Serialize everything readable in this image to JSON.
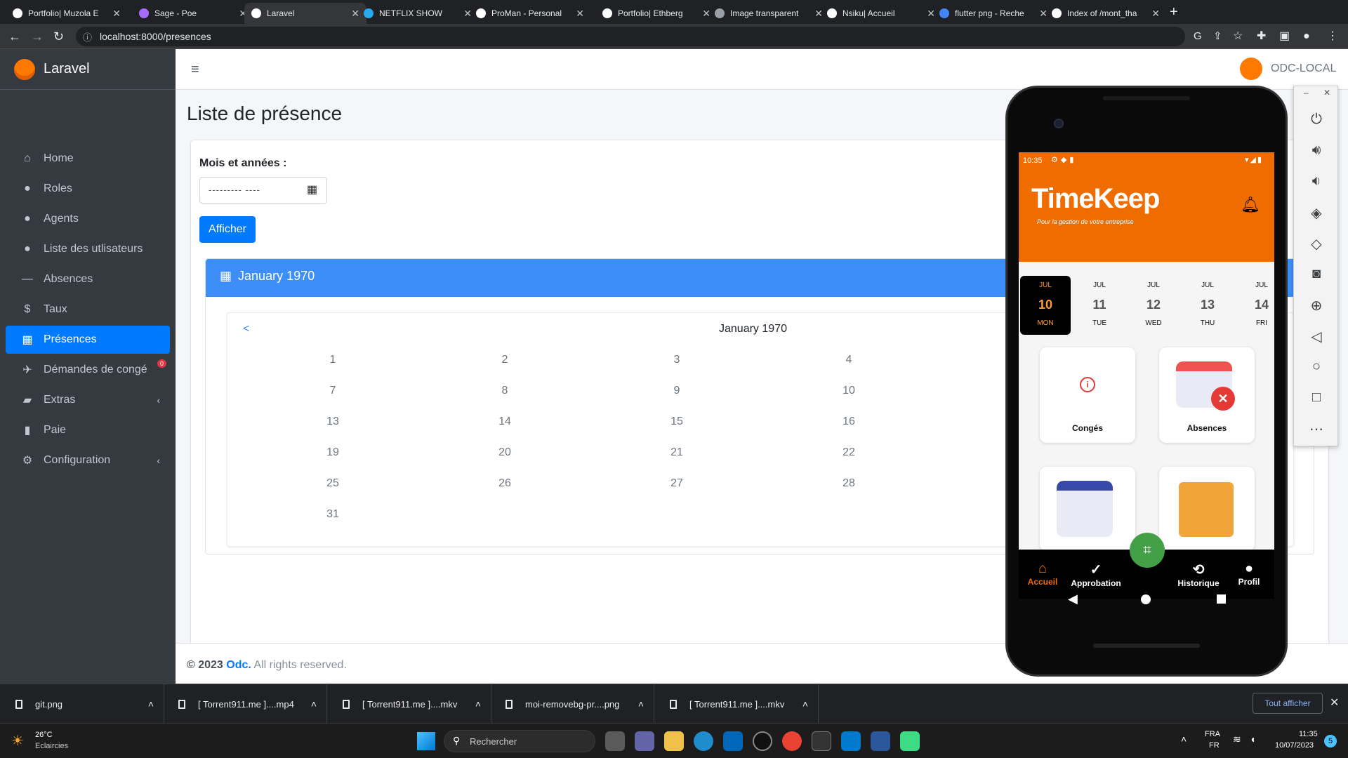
{
  "browser": {
    "tabs": [
      {
        "label": "Portfolio| Muzola E",
        "fav": "#ffffff"
      },
      {
        "label": "Sage - Poe",
        "fav": "#a86bff"
      },
      {
        "label": "Laravel",
        "fav": "#ffffff",
        "active": true
      },
      {
        "label": "NETFLIX SHOW",
        "fav": "#29a9eb"
      },
      {
        "label": "ProMan - Personal",
        "fav": "#ffffff"
      },
      {
        "label": "Portfolio| Ethberg",
        "fav": "#ffffff"
      },
      {
        "label": "Image transparent",
        "fav": "#9aa0a6"
      },
      {
        "label": "Nsiku| Accueil",
        "fav": "#ffffff"
      },
      {
        "label": "flutter png - Reche",
        "fav": "#4285f4"
      },
      {
        "label": "Index of /mont_tha",
        "fav": "#ffffff"
      }
    ],
    "url": "localhost:8000/presences"
  },
  "sidebar": {
    "brand": "Laravel",
    "items": [
      {
        "label": "Home",
        "icon": "home-icon",
        "glyph": "⌂"
      },
      {
        "label": "Roles",
        "icon": "user-icon",
        "glyph": "●"
      },
      {
        "label": "Agents",
        "icon": "user-plus-icon",
        "glyph": "●"
      },
      {
        "label": "Liste des utlisateurs",
        "icon": "users-icon",
        "glyph": "●"
      },
      {
        "label": "Absences",
        "icon": "minus-icon",
        "glyph": "—"
      },
      {
        "label": "Taux",
        "icon": "dollar-icon",
        "glyph": "$"
      },
      {
        "label": "Présences",
        "icon": "grid-icon",
        "glyph": "▦",
        "active": true
      },
      {
        "label": "Démandes de congé",
        "icon": "plane-icon",
        "glyph": "✈",
        "badge": "0"
      },
      {
        "label": "Extras",
        "icon": "briefcase-icon",
        "glyph": "▰",
        "chevron": true
      },
      {
        "label": "Paie",
        "icon": "file-icon",
        "glyph": "▮"
      },
      {
        "label": "Configuration",
        "icon": "gear-icon",
        "glyph": "⚙",
        "chevron": true
      }
    ]
  },
  "topnav": {
    "org": "ODC-LOCAL"
  },
  "main": {
    "title": "Liste de présence",
    "month_label": "Mois et années :",
    "month_placeholder": "--------- ----",
    "submit_label": "Afficher",
    "calendar_header": "January 1970",
    "calendar_title": "January 1970",
    "prev": "<",
    "days": [
      [
        "1",
        "2",
        "3",
        "4"
      ],
      [
        "7",
        "8",
        "9",
        "10"
      ],
      [
        "13",
        "14",
        "15",
        "16"
      ],
      [
        "19",
        "20",
        "21",
        "22"
      ],
      [
        "25",
        "26",
        "27",
        "28"
      ],
      [
        "31"
      ]
    ]
  },
  "footer": {
    "copy": "© 2023",
    "company": "Odc.",
    "rights": "All rights reserved."
  },
  "phone": {
    "status_time": "10:35",
    "app_title": "TimeKeep",
    "app_subtitle": "Pour la gestion de votre entreprise",
    "dates": [
      {
        "month": "JUL",
        "day": "10",
        "dow": "MON",
        "selected": true
      },
      {
        "month": "JUL",
        "day": "11",
        "dow": "TUE"
      },
      {
        "month": "JUL",
        "day": "12",
        "dow": "WED"
      },
      {
        "month": "JUL",
        "day": "13",
        "dow": "THU"
      },
      {
        "month": "JUL",
        "day": "14",
        "dow": "FRI"
      }
    ],
    "tiles": [
      "Congés",
      "Absences"
    ],
    "nav": [
      "Accueil",
      "Approbation",
      "Historique",
      "Profil"
    ],
    "accent": "#ef6c00"
  },
  "downloads": {
    "files": [
      "git.png",
      "[ Torrent911.me ]....mp4",
      "[ Torrent911.me ]....mkv",
      "moi-removebg-pr....png",
      "[ Torrent911.me ]....mkv"
    ],
    "show_all": "Tout afficher"
  },
  "taskbar": {
    "temp": "26°C",
    "weather": "Eclaircies",
    "search": "Rechercher",
    "lang": "FRA",
    "lang2": "FR",
    "time": "11:35",
    "date": "10/07/2023",
    "notif": "5"
  }
}
